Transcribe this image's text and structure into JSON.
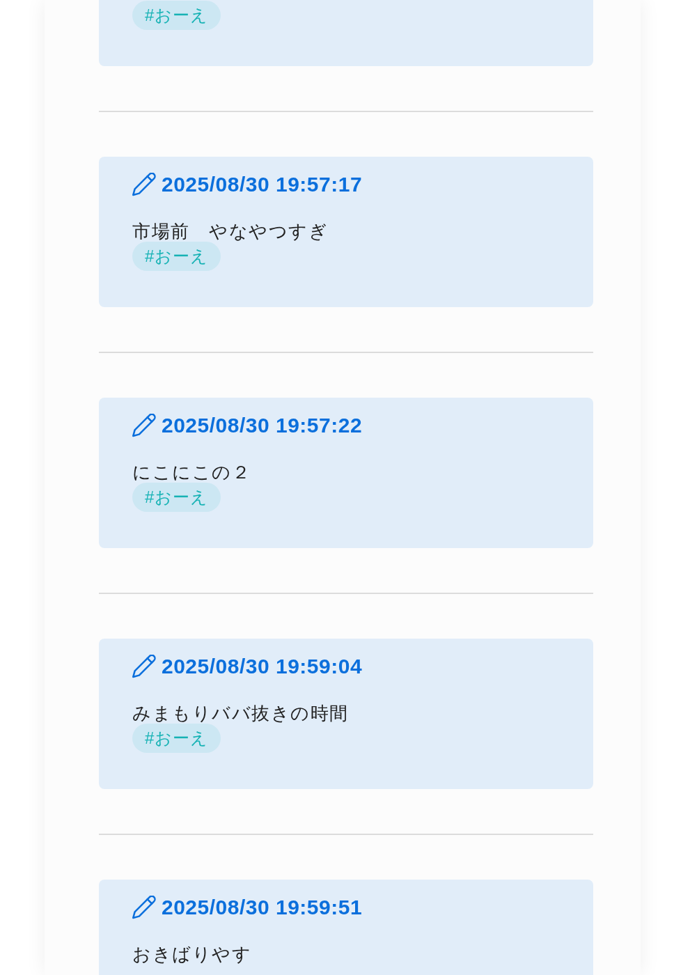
{
  "posts": [
    {
      "tags": [
        "#おーえ"
      ]
    },
    {
      "timestamp": "2025/08/30 19:57:17",
      "text": "市場前　やなやつすぎ",
      "tags": [
        "#おーえ"
      ]
    },
    {
      "timestamp": "2025/08/30 19:57:22",
      "text": "にこにこの２",
      "tags": [
        "#おーえ"
      ]
    },
    {
      "timestamp": "2025/08/30 19:59:04",
      "text": "みまもりババ抜きの時間",
      "tags": [
        "#おーえ"
      ]
    },
    {
      "timestamp": "2025/08/30 19:59:51",
      "text": "おきばりやす"
    }
  ]
}
